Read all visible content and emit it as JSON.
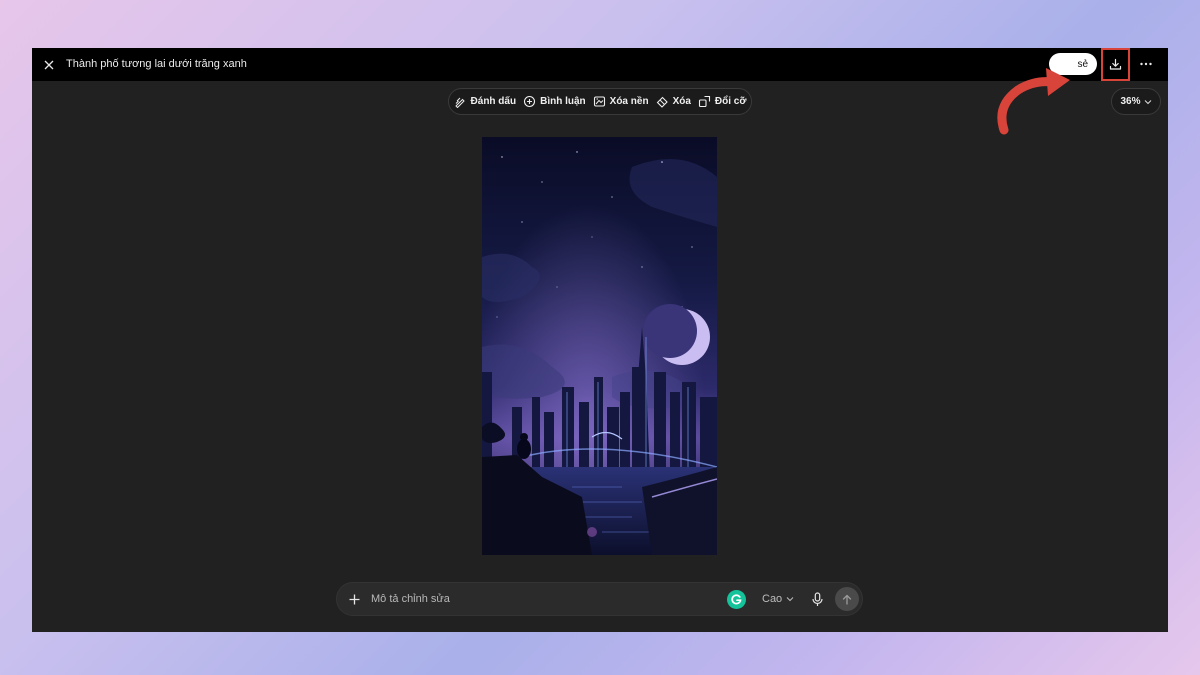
{
  "window": {
    "title": "Thành phố tương lai dưới trăng xanh",
    "share_label": "Chia sẻ",
    "share_visible_text": "sẻ"
  },
  "toolbar": {
    "items": [
      {
        "label": "Đánh dấu",
        "icon": "pen-mark-icon"
      },
      {
        "label": "Bình luận",
        "icon": "comment-plus-icon"
      },
      {
        "label": "Xóa nền",
        "icon": "remove-background-icon"
      },
      {
        "label": "Xóa",
        "icon": "eraser-icon"
      },
      {
        "label": "Đổi cỡ",
        "icon": "resize-icon"
      }
    ],
    "zoom": "36%"
  },
  "prompt": {
    "placeholder": "Mô tả chỉnh sửa",
    "quality": "Cao"
  },
  "colors": {
    "highlight_box": "#d9443a",
    "arrow": "#d9443a",
    "canvas_bg": "#212121",
    "topbar_bg": "#000000"
  }
}
